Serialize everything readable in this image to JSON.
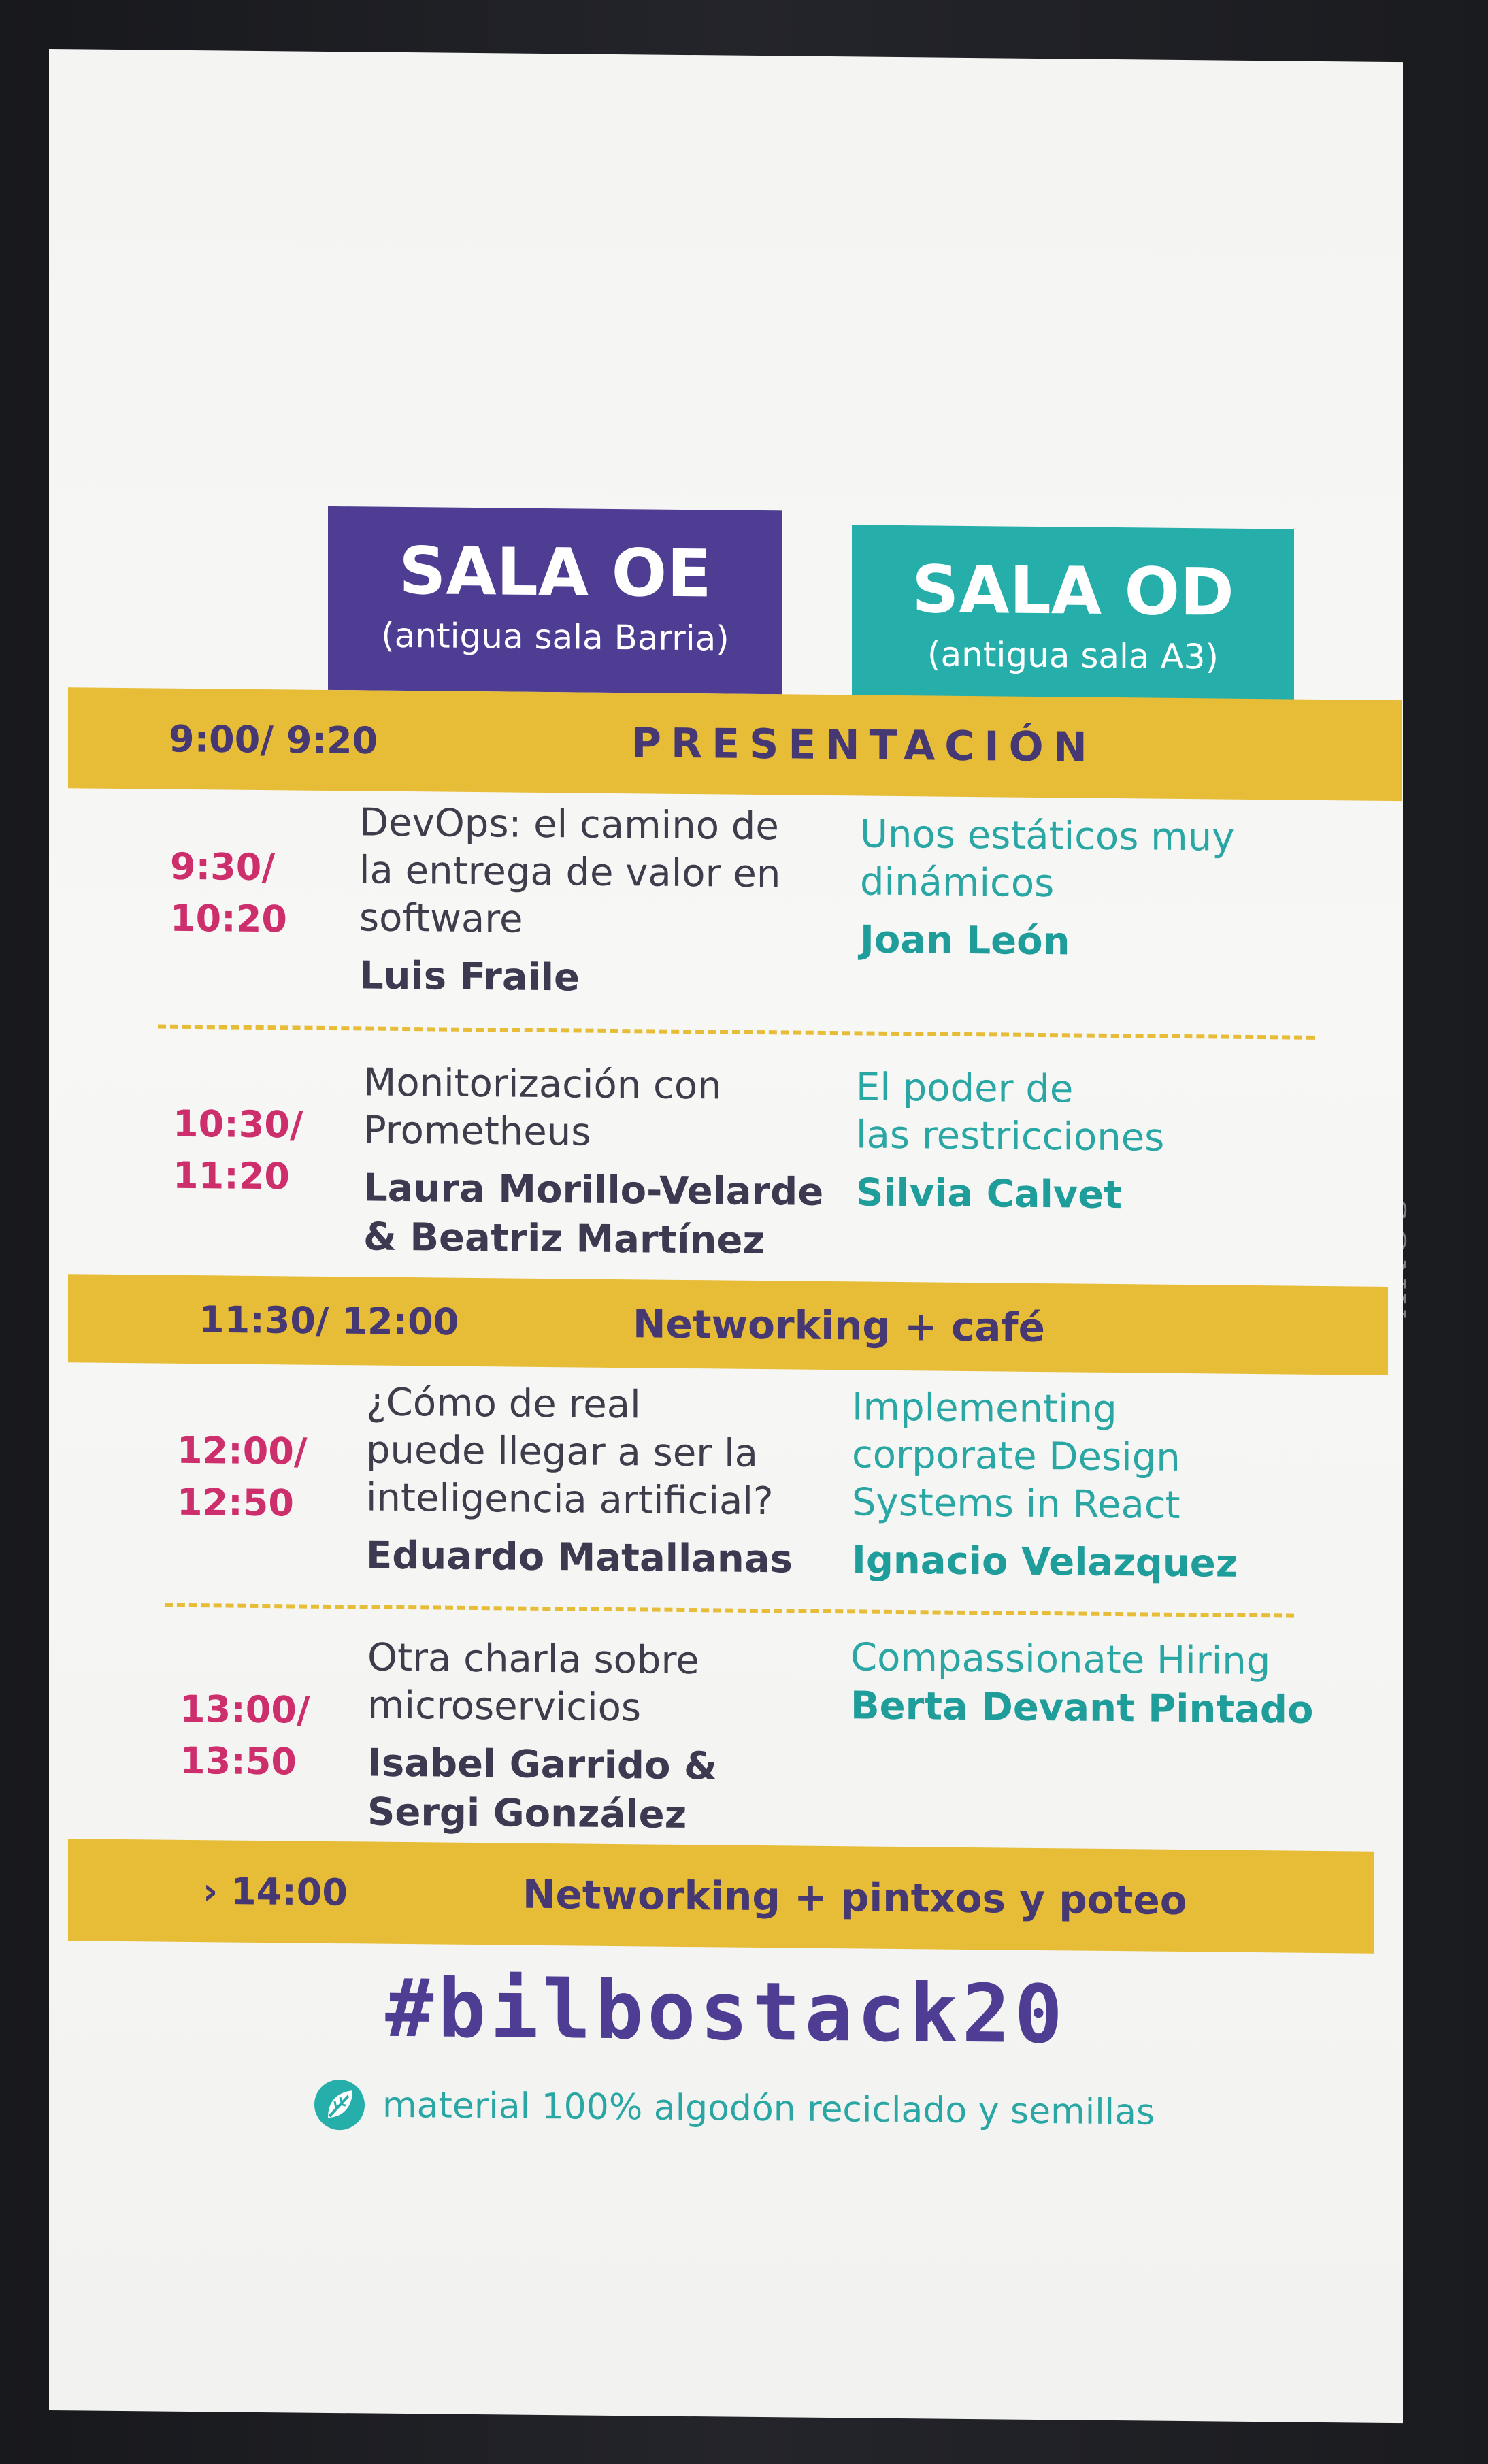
{
  "rooms": {
    "oe": {
      "name": "SALA OE",
      "note": "(antigua sala Barria)"
    },
    "od": {
      "name": "SALA OD",
      "note": "(antigua sala A3)"
    }
  },
  "bands": [
    {
      "time": "9:00/ 9:20",
      "title": "PRESENTACIÓN"
    },
    {
      "time": "11:30/ 12:00",
      "title": "Networking + café"
    },
    {
      "time": "› 14:00",
      "title": "Networking + pintxos y poteo"
    }
  ],
  "slots": [
    {
      "time_start": "9:30/",
      "time_end": "10:20",
      "oe": {
        "title": [
          "DevOps: el camino de",
          "la entrega de valor en",
          "software"
        ],
        "speaker": [
          "Luis Fraile"
        ]
      },
      "od": {
        "title": [
          "Unos estáticos muy",
          "dinámicos"
        ],
        "speaker": [
          "Joan León"
        ]
      }
    },
    {
      "time_start": "10:30/",
      "time_end": "11:20",
      "oe": {
        "title": [
          "Monitorización con",
          "Prometheus"
        ],
        "speaker": [
          "Laura Morillo-Velarde",
          "& Beatriz Martínez"
        ]
      },
      "od": {
        "title": [
          "El poder de",
          "las restricciones"
        ],
        "speaker": [
          "Silvia Calvet"
        ]
      }
    },
    {
      "time_start": "12:00/",
      "time_end": "12:50",
      "oe": {
        "title": [
          "¿Cómo de real",
          "puede llegar a ser la",
          "inteligencia artificial?"
        ],
        "speaker": [
          "Eduardo Matallanas"
        ]
      },
      "od": {
        "title": [
          "Implementing",
          "corporate Design",
          "Systems in React"
        ],
        "speaker": [
          "Ignacio Velazquez"
        ]
      }
    },
    {
      "time_start": "13:00/",
      "time_end": "13:50",
      "oe": {
        "title": [
          "Otra charla sobre",
          "microservicios"
        ],
        "speaker": [
          "Isabel Garrido &",
          "Sergi González"
        ]
      },
      "od": {
        "title": [
          "Compassionate Hiring"
        ],
        "speaker": [
          "Berta Devant Pintado"
        ]
      }
    }
  ],
  "hashtag": "#bilbostack20",
  "footnote": "material 100% algodón reciclado y semillas",
  "brand": "SONY",
  "colors": {
    "purple": "#4e3d93",
    "teal": "#25aeaa",
    "yellow": "#e7bd37",
    "magenta": "#cd2f6d"
  },
  "icons": {
    "footnote_icon": "leaf-icon"
  }
}
